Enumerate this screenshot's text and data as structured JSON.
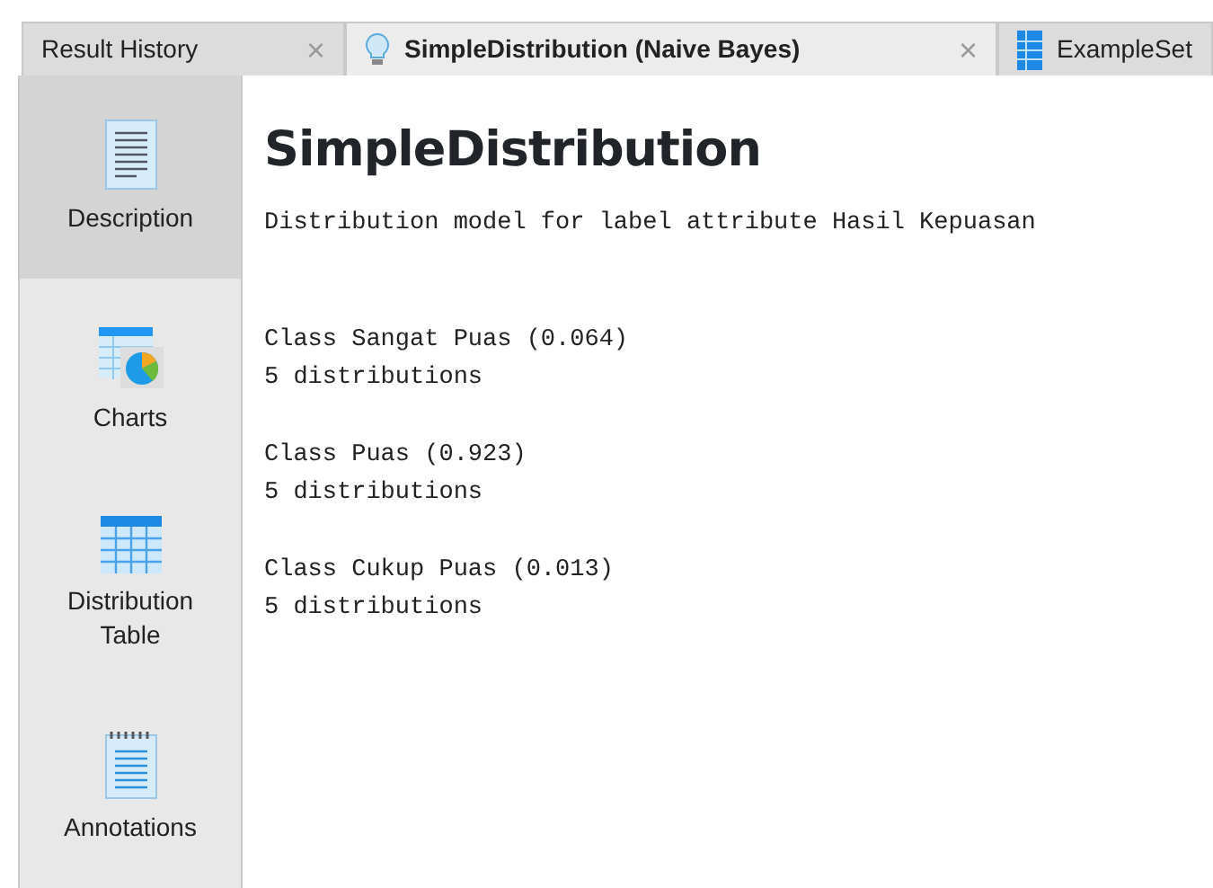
{
  "tabs": [
    {
      "label": "Result History",
      "kind": "plain",
      "close": "×",
      "selected": false
    },
    {
      "label": "SimpleDistribution (Naive Bayes)",
      "kind": "model",
      "close": "×",
      "selected": true
    },
    {
      "label": "ExampleSet",
      "kind": "data",
      "selected": false
    }
  ],
  "sidebar": {
    "items": [
      {
        "label": "Description",
        "kind": "description",
        "selected": true
      },
      {
        "label": "Charts",
        "kind": "charts",
        "selected": false
      },
      {
        "label": "Distribution Table",
        "kind": "table",
        "selected": false
      },
      {
        "label": "Annotations",
        "kind": "annotations",
        "selected": false
      }
    ]
  },
  "content": {
    "title": "SimpleDistribution",
    "subtitle": "Distribution model for label attribute Hasil Kepuasan",
    "classes": [
      {
        "name": "Class Sangat Puas (0.064)",
        "detail": "5 distributions"
      },
      {
        "name": "Class Puas (0.923)",
        "detail": "5 distributions"
      },
      {
        "name": "Class Cukup Puas (0.013)",
        "detail": "5 distributions"
      }
    ]
  }
}
